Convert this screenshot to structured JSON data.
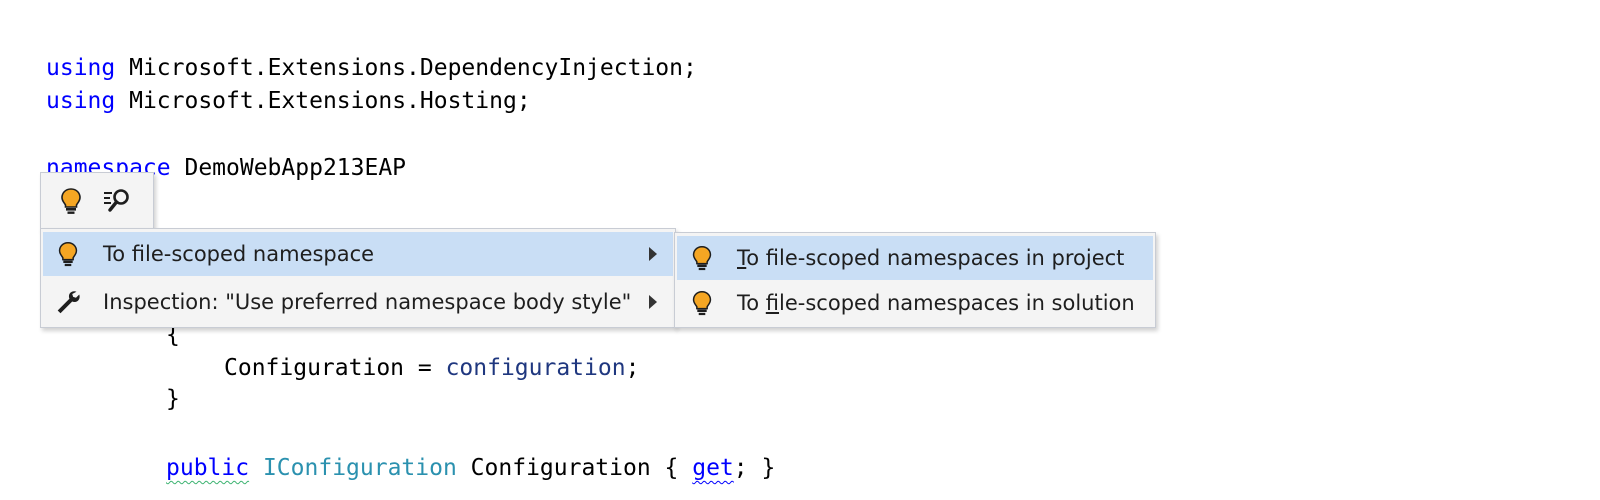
{
  "code": {
    "line1": {
      "kw": "using",
      "text": " Microsoft.Extensions.DependencyInjection;"
    },
    "line2": {
      "kw": "using",
      "text": " Microsoft.Extensions.Hosting;"
    },
    "line3": {
      "kw": "namespace",
      "text": " DemoWebApp213EAP"
    },
    "line4": {
      "text": "{"
    },
    "line5": {
      "prop": "Configuration",
      "op": " = ",
      "param": "configuration",
      "end": ";"
    },
    "line6": {
      "text": "}"
    },
    "line7": {
      "kw": "public",
      "type": "IConfiguration",
      "prop": " Configuration { ",
      "accessor": "get",
      "end": "; }"
    }
  },
  "icon_strip": {
    "icons": [
      "lightbulb-icon",
      "find-usages-icon"
    ]
  },
  "menu": {
    "items": [
      {
        "label": "To file-scoped namespace",
        "icon": "lightbulb-icon",
        "selected": true,
        "has_submenu": true
      },
      {
        "label": "Inspection: \"Use preferred namespace body style\"",
        "icon": "wrench-icon",
        "selected": false,
        "has_submenu": true
      }
    ]
  },
  "submenu": {
    "items": [
      {
        "mnemonic": "T",
        "rest": "o file-scoped namespaces in project",
        "icon": "lightbulb-icon",
        "selected": true
      },
      {
        "before": "To ",
        "mnemonic": "f",
        "rest": "ile-scoped namespaces in solution",
        "icon": "lightbulb-icon",
        "selected": false
      }
    ]
  },
  "colors": {
    "keyword": "#0000ff",
    "type": "#2b91af",
    "parameter": "#1f377f",
    "selection": "#c9def5",
    "popup_bg": "#f4f4f4",
    "bulb": "#f5a623"
  }
}
